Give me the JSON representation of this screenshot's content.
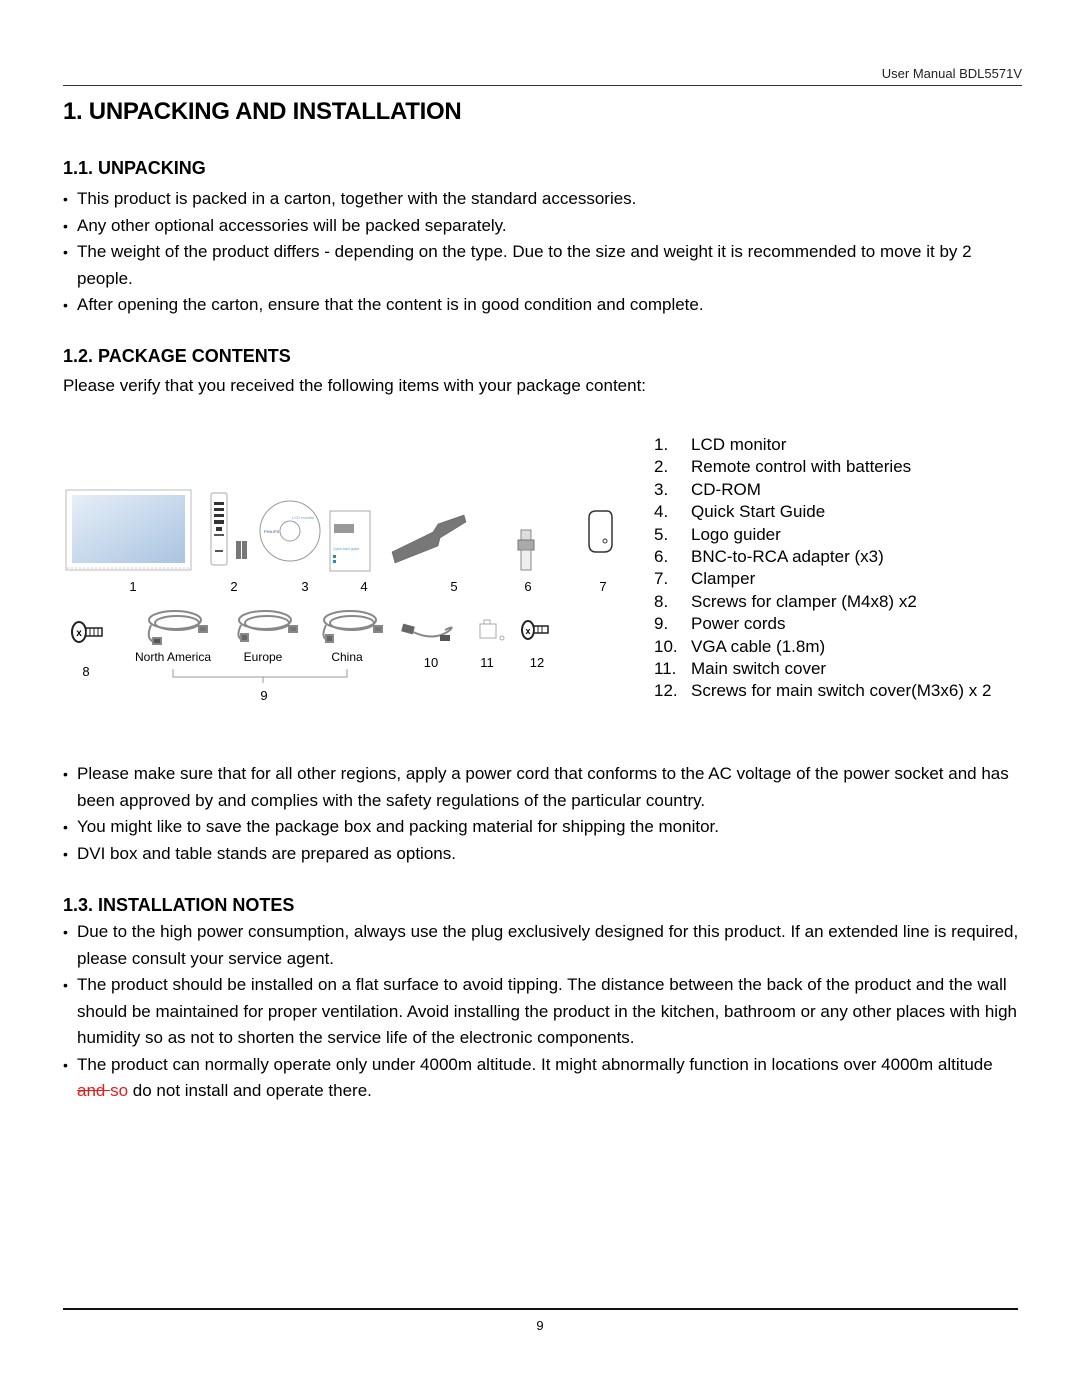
{
  "header": {
    "running_title": "User Manual BDL5571V"
  },
  "chapter": {
    "title": "1.  UNPACKING AND INSTALLATION"
  },
  "sections": {
    "unpacking": {
      "title": "1.1.  UNPACKING",
      "bullets": [
        "This product is packed in a carton, together with the standard accessories.",
        "Any other optional accessories will be packed separately.",
        "The weight of the product differs - depending on the type. Due to the size and weight it is recommended to move it by 2 people.",
        "After opening the carton, ensure that the content is in good condition and complete."
      ]
    },
    "package_contents": {
      "title": "1.2.  PACKAGE CONTENTS",
      "intro": "Please verify that you received the following items with your package content:",
      "items": [
        {
          "num": "1.",
          "label": "LCD monitor"
        },
        {
          "num": "2.",
          "label": "Remote control with batteries"
        },
        {
          "num": "3.",
          "label": "CD-ROM"
        },
        {
          "num": "4.",
          "label": "Quick Start Guide"
        },
        {
          "num": "5.",
          "label": "Logo guider"
        },
        {
          "num": "6.",
          "label": "BNC-to-RCA adapter (x3)"
        },
        {
          "num": "7.",
          "label": "Clamper"
        },
        {
          "num": "8.",
          "label": "Screws for clamper (M4x8) x2"
        },
        {
          "num": "9.",
          "label": "Power cords"
        },
        {
          "num": "10.",
          "label": "VGA cable (1.8m)"
        },
        {
          "num": "11.",
          "label": "Main switch cover"
        },
        {
          "num": "12.",
          "label": "Screws for main switch cover(M3x6) x 2"
        }
      ],
      "figure": {
        "top_labels": [
          "1",
          "2",
          "3",
          "4",
          "5",
          "6",
          "7"
        ],
        "bottom_labels": [
          "8",
          "10",
          "11",
          "12"
        ],
        "cord_regions": [
          "North America",
          "Europe",
          "China"
        ],
        "cord_group_label": "9",
        "brand_text": "PHILIPS",
        "cd_text": "LCD monitor",
        "guide_text": "Quick start guide"
      },
      "bullets": [
        "Please make sure that for all other regions, apply a power cord that conforms to the AC voltage of the power socket and has been approved by and complies with the safety regulations of the particular country.",
        "You might like to save the package box and packing material for shipping the monitor.",
        "DVI box and table stands are prepared as options."
      ]
    },
    "installation_notes": {
      "title": "1.3.  INSTALLATION NOTES",
      "bullets": [
        "Due to the high power consumption, always use the plug exclusively designed for this product. If an extended line is required, please consult your service agent.",
        "The product should be installed on a flat surface to avoid tipping. The distance between the back of the product and the wall should be maintained for proper ventilation. Avoid installing the product in the kitchen, bathroom or any other places with high humidity so as not to shorten the service life of the electronic components."
      ],
      "last_bullet": {
        "before": "The product can normally operate only under 4000m altitude. It might abnormally function in locations over 4000m altitude ",
        "deleted": "and ",
        "inserted": "so",
        "after": " do not install and operate there."
      }
    }
  },
  "footer": {
    "page_number": "9"
  }
}
